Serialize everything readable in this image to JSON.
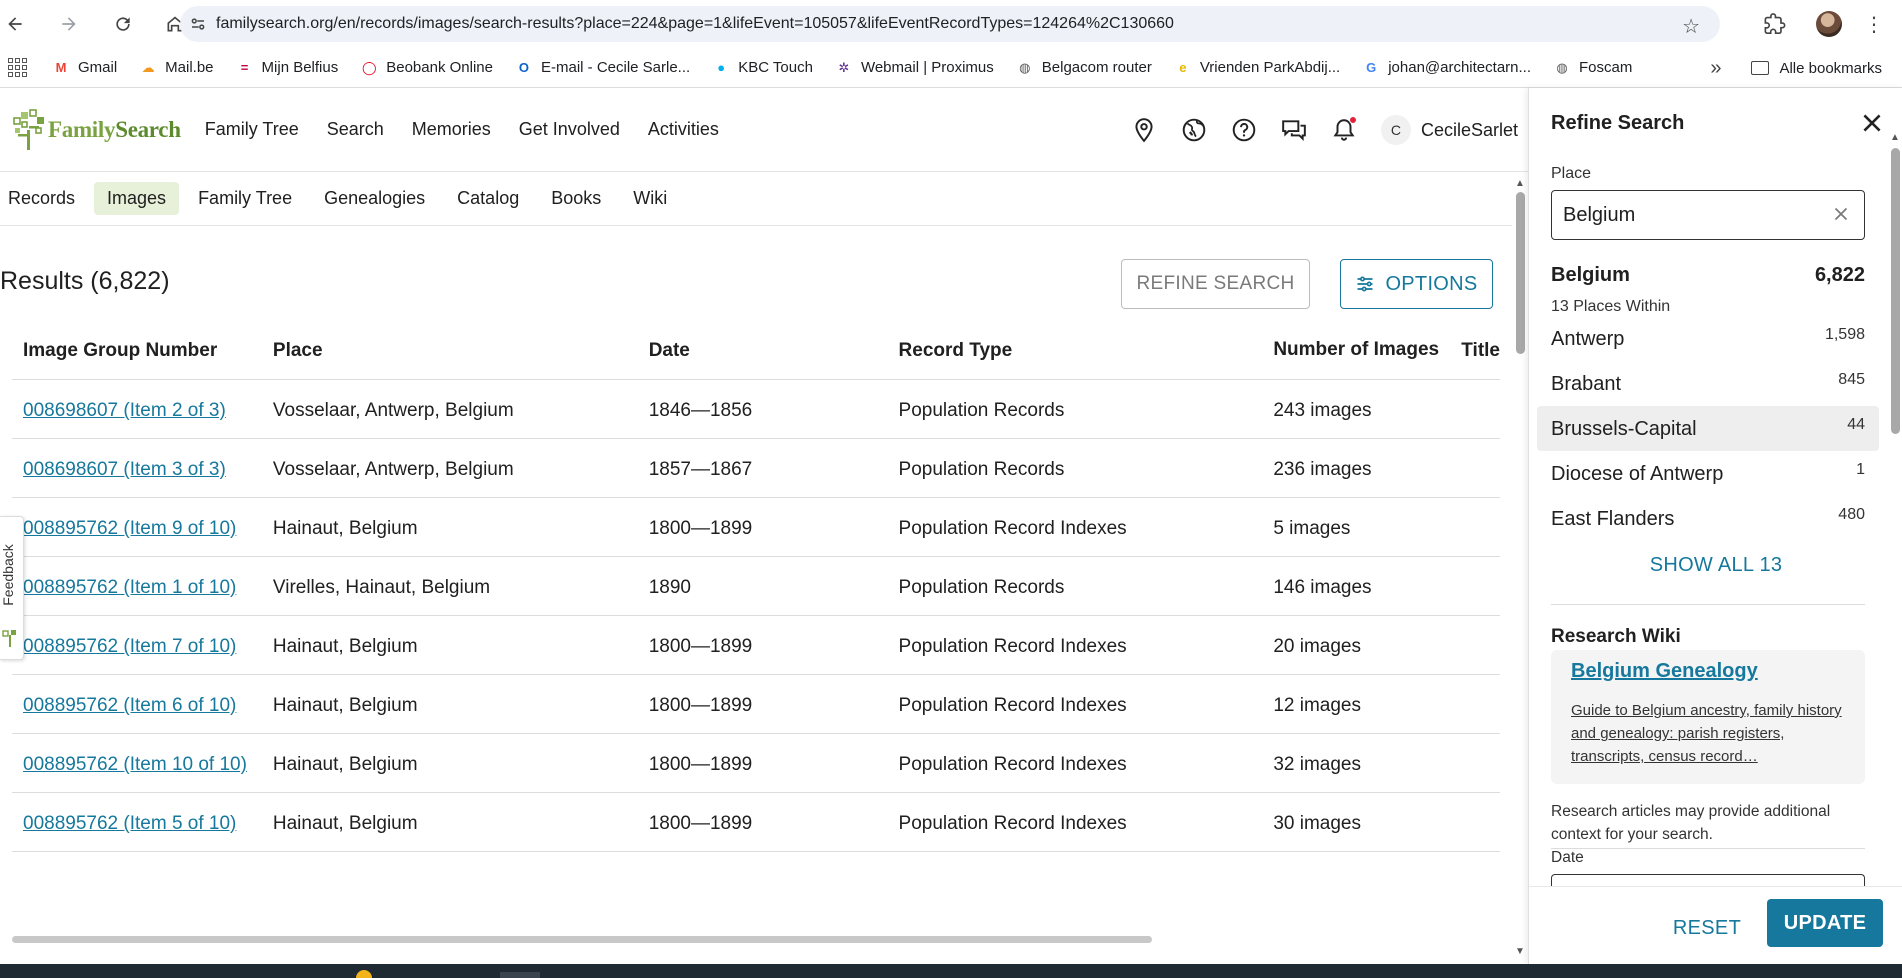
{
  "browser": {
    "url": "familysearch.org/en/records/images/search-results?place=224&page=1&lifeEvent=105057&lifeEventRecordTypes=124264%2C130660",
    "bookmarks": [
      {
        "label": "Gmail",
        "color": "#ea4335",
        "glyph": "M"
      },
      {
        "label": "Mail.be",
        "color": "#f39a1e",
        "glyph": "☁"
      },
      {
        "label": "Mijn Belfius",
        "color": "#c30045",
        "glyph": "="
      },
      {
        "label": "Beobank Online",
        "color": "#e2001a",
        "glyph": "◯"
      },
      {
        "label": "E-mail - Cecile Sarle...",
        "color": "#0a64c8",
        "glyph": "O"
      },
      {
        "label": "KBC Touch",
        "color": "#00aeef",
        "glyph": "●"
      },
      {
        "label": "Webmail | Proximus",
        "color": "#5c2d91",
        "glyph": "✲"
      },
      {
        "label": "Belgacom router",
        "color": "#555555",
        "glyph": "◍"
      },
      {
        "label": "Vrienden ParkAbdij...",
        "color": "#e6b800",
        "glyph": "e"
      },
      {
        "label": "johan@architectarn...",
        "color": "#4285f4",
        "glyph": "G"
      },
      {
        "label": "Foscam",
        "color": "#555555",
        "glyph": "◍"
      }
    ],
    "more_bookmarks": "»",
    "all_bookmarks": "Alle bookmarks"
  },
  "header": {
    "logo_text_a": "Family",
    "logo_text_b": "Search",
    "nav": [
      "Family Tree",
      "Search",
      "Memories",
      "Get Involved",
      "Activities"
    ],
    "user_initial": "C",
    "user_name": "CecileSarlet"
  },
  "subtabs": [
    "Records",
    "Images",
    "Family Tree",
    "Genealogies",
    "Catalog",
    "Books",
    "Wiki"
  ],
  "active_subtab": "Images",
  "results": {
    "title": "Results (6,822)",
    "refine_button": "REFINE SEARCH",
    "options_button": "OPTIONS",
    "columns": [
      "Image Group Number",
      "Place",
      "Date",
      "Record Type",
      "Number of Images",
      "Title"
    ],
    "rows": [
      {
        "group": "008698607 (Item 2 of 3)",
        "place": "Vosselaar, Antwerp, Belgium",
        "date": "1846—1856",
        "type": "Population Records",
        "images": "243 images"
      },
      {
        "group": "008698607 (Item 3 of 3)",
        "place": "Vosselaar, Antwerp, Belgium",
        "date": "1857—1867",
        "type": "Population Records",
        "images": "236 images"
      },
      {
        "group": "008895762 (Item 9 of 10)",
        "place": "Hainaut, Belgium",
        "date": "1800—1899",
        "type": "Population Record Indexes",
        "images": "5 images"
      },
      {
        "group": "008895762 (Item 1 of 10)",
        "place": "Virelles, Hainaut, Belgium",
        "date": "1890",
        "type": "Population Records",
        "images": "146 images"
      },
      {
        "group": "008895762 (Item 7 of 10)",
        "place": "Hainaut, Belgium",
        "date": "1800—1899",
        "type": "Population Record Indexes",
        "images": "20 images"
      },
      {
        "group": "008895762 (Item 6 of 10)",
        "place": "Hainaut, Belgium",
        "date": "1800—1899",
        "type": "Population Record Indexes",
        "images": "12 images"
      },
      {
        "group": "008895762 (Item 10 of 10)",
        "place": "Hainaut, Belgium",
        "date": "1800—1899",
        "type": "Population Record Indexes",
        "images": "32 images"
      },
      {
        "group": "008895762 (Item 5 of 10)",
        "place": "Hainaut, Belgium",
        "date": "1800—1899",
        "type": "Population Record Indexes",
        "images": "30 images"
      }
    ]
  },
  "feedback_label": "Feedback",
  "refine_panel": {
    "title": "Refine Search",
    "place_label": "Place",
    "place_value": "Belgium",
    "total_place": "Belgium",
    "total_count": "6,822",
    "places_within": "13 Places Within",
    "places": [
      {
        "name": "Antwerp",
        "count": "1,598"
      },
      {
        "name": "Brabant",
        "count": "845"
      },
      {
        "name": "Brussels-Capital",
        "count": "44"
      },
      {
        "name": "Diocese of Antwerp",
        "count": "1"
      },
      {
        "name": "East Flanders",
        "count": "480"
      }
    ],
    "show_all": "SHOW ALL 13",
    "wiki_heading": "Research Wiki",
    "wiki_link": "Belgium Genealogy",
    "wiki_desc": "Guide to Belgium ancestry, family history and genealogy: parish registers, transcripts, census record…",
    "wiki_note": "Research articles may provide additional context for your search.",
    "date_label": "Date",
    "reset_button": "RESET",
    "update_button": "UPDATE"
  },
  "colors": {
    "link": "#16789c",
    "brand_green": "#7aa240",
    "active_tab_bg": "#e7f0d8"
  }
}
